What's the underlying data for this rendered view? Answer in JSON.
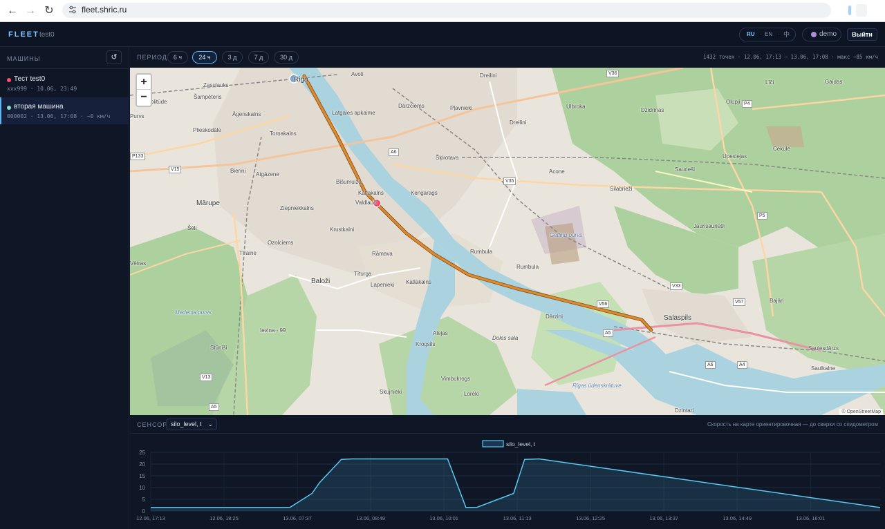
{
  "browser": {
    "url": "fleet.shric.ru"
  },
  "header": {
    "brand": "FLEET",
    "subtitle": "test0",
    "languages": [
      "RU",
      "EN",
      "中"
    ],
    "active_language": "RU",
    "user": "demo",
    "logout_label": "Выйти"
  },
  "sidebar": {
    "title": "МАШИНЫ",
    "refresh_icon": "↺",
    "vehicles": [
      {
        "name": "Тест test0",
        "meta": "xxx999 · 10.06, 23:49",
        "status_color": "#ff4d6a",
        "active": false
      },
      {
        "name": "вторая машина",
        "meta": "000002 · 13.06, 17:08 · ~0 км/ч",
        "status_color": "#7fe0c7",
        "active": true
      }
    ]
  },
  "period": {
    "label": "ПЕРИОД",
    "options": [
      "6 ч",
      "24 ч",
      "3 д",
      "7 д",
      "30 д"
    ],
    "selected": "24 ч",
    "summary": "1432 точек · 12.06, 17:13 — 13.06, 17:08 · макс ~85 км/ч"
  },
  "map": {
    "zoom_in": "+",
    "zoom_out": "−",
    "attribution": "© OpenStreetMap",
    "places": [
      {
        "name": "Avoti"
      },
      {
        "name": "Dreilini"
      },
      {
        "name": "Zasulauks"
      },
      {
        "name": "Šampēteris"
      },
      {
        "name": "Zolitūde"
      },
      {
        "name": "Āgenskalns"
      },
      {
        "name": "Latgales apkaime"
      },
      {
        "name": "Dārzciems"
      },
      {
        "name": "Pļavnieki"
      },
      {
        "name": "Ulbroka"
      },
      {
        "name": "Dzidrinas"
      },
      {
        "name": "Plieskodāle"
      },
      {
        "name": "Torņakalns"
      },
      {
        "name": "Dreilini"
      },
      {
        "name": "Šķirotava"
      },
      {
        "name": "Acone"
      },
      {
        "name": "Bierini"
      },
      {
        "name": "Atgāzene"
      },
      {
        "name": "Bišumuiža"
      },
      {
        "name": "Katlakalns"
      },
      {
        "name": "Kengarags"
      },
      {
        "name": "Silabrieži"
      },
      {
        "name": "Mārupe"
      },
      {
        "name": "Ziepniekkalns"
      },
      {
        "name": "Valdlauči"
      },
      {
        "name": "Jaunsaurieši"
      },
      {
        "name": "Šēli"
      },
      {
        "name": "Krustkalni"
      },
      {
        "name": "Ozolciems"
      },
      {
        "name": "Rumbula"
      },
      {
        "name": "Tīraine"
      },
      {
        "name": "Rāmava"
      },
      {
        "name": "Baloži"
      },
      {
        "name": "Tīturga"
      },
      {
        "name": "Katlakalns"
      },
      {
        "name": "Lapenieki"
      },
      {
        "name": "Dārzini"
      },
      {
        "name": "Salaspils"
      },
      {
        "name": "Ievina - 99"
      },
      {
        "name": "Doles sala"
      },
      {
        "name": "Alejas"
      },
      {
        "name": "Krogsils"
      },
      {
        "name": "Vimbukrogs"
      },
      {
        "name": "Skujnieki"
      },
      {
        "name": "Lorēki"
      },
      {
        "name": "Rīgas ūdenskrātuve"
      },
      {
        "name": "Medema purvs"
      },
      {
        "name": "Dzintari"
      },
      {
        "name": "Saulesdārzs"
      },
      {
        "name": "Saulkalne"
      },
      {
        "name": "Gaidas"
      },
      {
        "name": "Līči"
      },
      {
        "name": "Olupji"
      },
      {
        "name": "Cekule"
      },
      {
        "name": "Upeslejas"
      },
      {
        "name": "Saurieši"
      },
      {
        "name": "Bajāri"
      },
      {
        "name": "Stūnīši"
      },
      {
        "name": "Riga"
      },
      {
        "name": "Rumbula"
      },
      {
        "name": "Getliņu purvs"
      },
      {
        "name": "Vētras"
      },
      {
        "name": "Purvs"
      }
    ],
    "road_shields": [
      "V36",
      "P4",
      "A6",
      "V15",
      "P133",
      "V35",
      "P5",
      "V33",
      "V57",
      "V56",
      "A5",
      "A4",
      "A6",
      "V13",
      "A5"
    ],
    "track_color": "#e08a2c",
    "vehicle_marker_color": "#ff3d5a"
  },
  "sensor": {
    "label": "СЕНСОР",
    "selected": "silo_level, t",
    "speed_note": "Скорость на карте ориентировочная — до сверки со спидометром"
  },
  "chart_data": {
    "type": "area",
    "title": "",
    "legend": [
      "silo_level, t"
    ],
    "legend_position": "top-center",
    "x_tick_labels": [
      "12.06, 17:13",
      "12.06, 18:25",
      "13.06, 07:37",
      "13.06, 08:49",
      "13.06, 10:01",
      "13.06, 11:13",
      "13.06, 12:25",
      "13.06, 13:37",
      "13.06, 14:49",
      "13.06, 16:01"
    ],
    "ylim": [
      0,
      25
    ],
    "y_ticks": [
      0,
      5,
      10,
      15,
      20,
      25
    ],
    "grid": true,
    "series_color": "#5ac8f0",
    "series": [
      {
        "name": "silo_level, t",
        "x": [
          0,
          1.8,
          1.9,
          2.2,
          2.3,
          2.6,
          2.75,
          3.0,
          4.05,
          4.3,
          4.45,
          4.95,
          5.1,
          5.3,
          9.95
        ],
        "values": [
          1.5,
          1.5,
          1.6,
          7.5,
          12.0,
          22.0,
          22.2,
          22.2,
          22.2,
          1.5,
          1.6,
          7.5,
          22.0,
          22.2,
          1.5
        ]
      }
    ]
  }
}
